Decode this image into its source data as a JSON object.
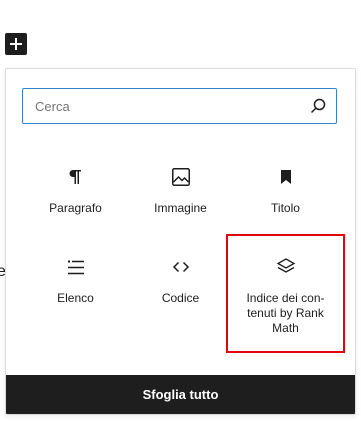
{
  "toolbar": {
    "add_block_icon": "plus-icon"
  },
  "background": {
    "edge_text": "e,"
  },
  "inserter": {
    "search": {
      "placeholder": "Cerca",
      "value": "",
      "icon": "search-icon"
    },
    "blocks": [
      {
        "label": "Paragrafo",
        "icon": "paragraph-icon"
      },
      {
        "label": "Immagine",
        "icon": "image-icon"
      },
      {
        "label": "Titolo",
        "icon": "bookmark-icon"
      },
      {
        "label": "Elenco",
        "icon": "list-icon"
      },
      {
        "label": "Codice",
        "icon": "code-icon"
      },
      {
        "label": "Indice dei con-tenuti by Rank Math",
        "icon": "layers-icon"
      }
    ],
    "browse_all_label": "Sfoglia tutto",
    "highlight_color": "#e1060d",
    "focus_color": "#3582c4"
  }
}
